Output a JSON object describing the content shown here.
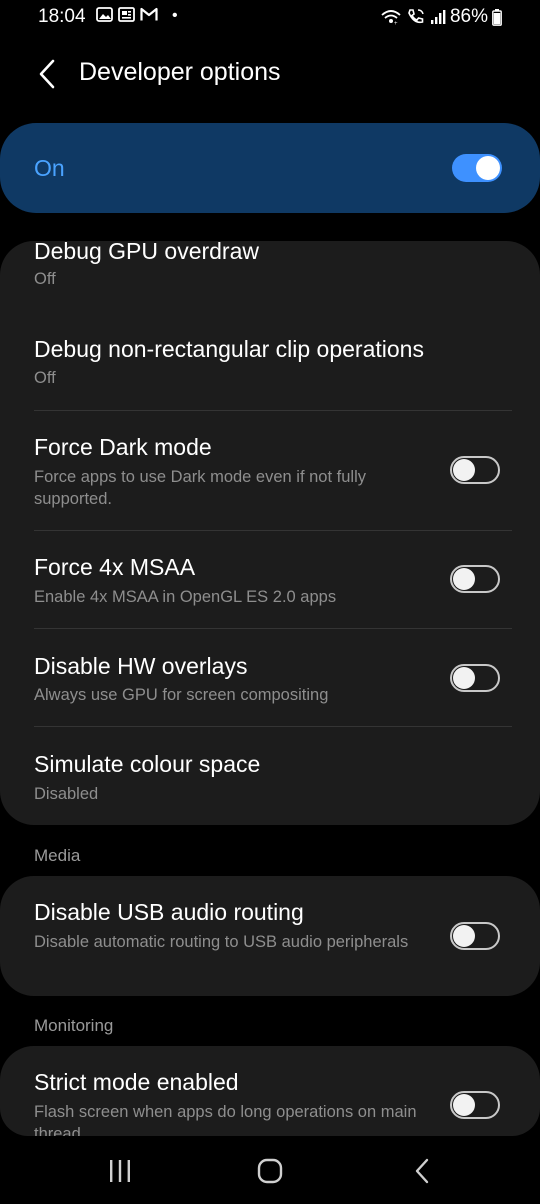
{
  "status_bar": {
    "time": "18:04",
    "icons_left": [
      "image-icon",
      "news-icon",
      "gmail-icon"
    ],
    "dot": "•",
    "icons_right": [
      "wifi-calling-icon",
      "volte-call-icon",
      "signal-icon"
    ],
    "battery": "86%"
  },
  "header": {
    "back_icon": "back-chevron-icon",
    "title": "Developer options"
  },
  "master_switch": {
    "label": "On",
    "state": true
  },
  "group1": {
    "items": [
      {
        "title": "Debug GPU overdraw",
        "subtitle": "Off"
      },
      {
        "title": "Debug non-rectangular clip operations",
        "subtitle": "Off"
      },
      {
        "title": "Force Dark mode",
        "subtitle": "Force apps to use Dark mode even if not fully supported.",
        "toggle": false
      },
      {
        "title": "Force 4x MSAA",
        "subtitle": "Enable 4x MSAA in OpenGL ES 2.0 apps",
        "toggle": false
      },
      {
        "title": "Disable HW overlays",
        "subtitle": "Always use GPU for screen compositing",
        "toggle": false
      },
      {
        "title": "Simulate colour space",
        "subtitle": "Disabled"
      }
    ]
  },
  "media": {
    "header": "Media",
    "items": [
      {
        "title": "Disable USB audio routing",
        "subtitle": "Disable automatic routing to USB audio peripherals",
        "toggle": false
      }
    ]
  },
  "monitoring": {
    "header": "Monitoring",
    "items": [
      {
        "title": "Strict mode enabled",
        "subtitle": "Flash screen when apps do long operations on main thread",
        "toggle": false
      }
    ]
  },
  "nav": {
    "recents_icon": "recents-icon",
    "home_icon": "home-icon",
    "back_icon": "nav-back-icon"
  },
  "colors": {
    "accent": "#3e91ff",
    "master_card": "#0f3964",
    "card_bg": "#1c1c1c",
    "background": "#000000"
  }
}
